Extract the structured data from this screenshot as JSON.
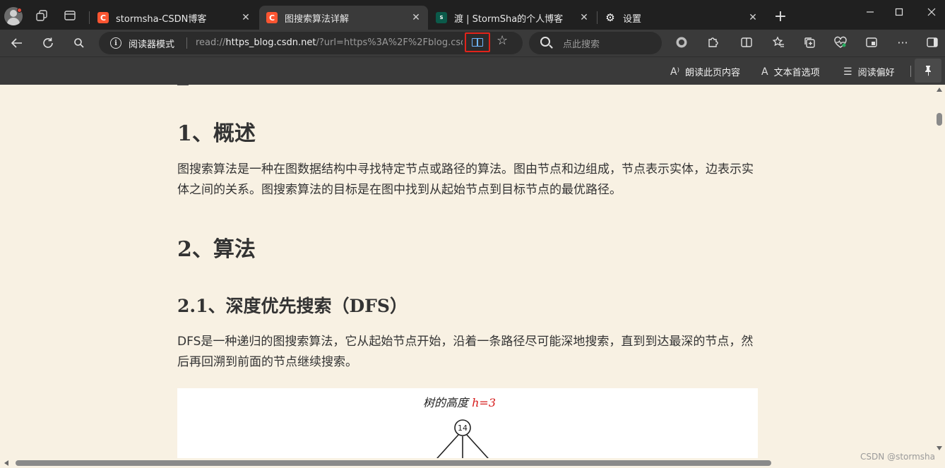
{
  "tabs": [
    {
      "title": "stormsha-CSDN博客",
      "favicon": "csdn-logo"
    },
    {
      "title": "图搜索算法详解",
      "favicon": "csdn-logo"
    },
    {
      "title": "渡 | StormSha的个人博客",
      "favicon": "S"
    },
    {
      "title": "设置",
      "favicon": "gear-icon"
    }
  ],
  "address_bar": {
    "mode_label": "阅读器模式",
    "url_prefix": "read://",
    "url_host": "https_blog.csdn.net",
    "url_rest": "/?url=https%3A%2F%2Fblog.csd..."
  },
  "search": {
    "placeholder": "点此搜索"
  },
  "reader_toolbar": {
    "read_aloud": "朗读此页内容",
    "text_prefs": "文本首选项",
    "reading_prefs": "阅读偏好"
  },
  "article": {
    "h_overview": "1、概述",
    "p_overview": "图搜索算法是一种在图数据结构中寻找特定节点或路径的算法。图由节点和边组成，节点表示实体，边表示实体之间的关系。图搜索算法的目标是在图中找到从起始节点到目标节点的最优路径。",
    "h_algorithms": "2、算法",
    "h_dfs": "2.1、深度优先搜索（DFS）",
    "p_dfs": "DFS是一种递归的图搜索算法，它从起始节点开始，沿着一条路径尽可能深地搜索，直到到达最深的节点，然后再回溯到前面的节点继续搜索。",
    "figure": {
      "caption_prefix": "树的高度",
      "caption_var": "h",
      "caption_eq": "=3",
      "root_value": "14"
    }
  },
  "watermark": "CSDN @stormsha",
  "colors": {
    "reader_bg": "#f8f1e3",
    "highlight": "#e2231a",
    "csdn_brand": "#fc5531"
  }
}
